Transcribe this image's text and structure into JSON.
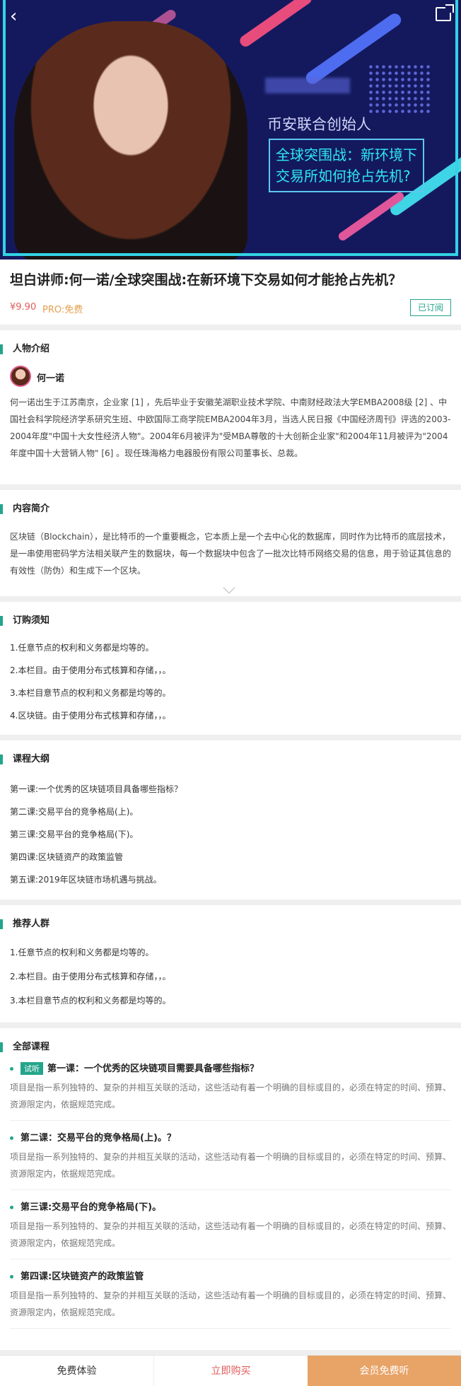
{
  "hero": {
    "subtitle": "币安联合创始人",
    "box_line1": "全球突围战：新环境下",
    "box_line2": "交易所如何抢占先机?",
    "back_icon": "chevron-left-icon",
    "share_icon": "share-icon"
  },
  "product": {
    "title": "坦白讲师:何一诺/全球突围战:在新环境下交易如何才能抢占先机？",
    "price": "¥9.90",
    "pro": "PRO:免费",
    "subscribed_label": "已订阅"
  },
  "intro": {
    "section_title": "人物介绍",
    "name": "何一诺",
    "text": "何一诺出生于江苏南京，企业家 [1] ，先后毕业于安徽芜湖职业技术学院、中南财经政法大学EMBA2008级 [2] 、中国社会科学院经济学系研究生班、中欧国际工商学院EMBA2004年3月，当选人民日报《中国经济周刊》评选的2003-2004年度\"中国十大女性经济人物\"。2004年6月被评为\"受MBA尊敬的十大创新企业家\"和2004年11月被评为\"2004年度中国十大营销人物\" [6] 。现任珠海格力电器股份有限公司董事长、总裁。"
  },
  "description": {
    "section_title": "内容简介",
    "text": "区块链（Blockchain），是比特币的一个重要概念，它本质上是一个去中心化的数据库，同时作为比特币的底层技术，是一串使用密码学方法相关联产生的数据块，每一个数据块中包含了一批次比特币网络交易的信息，用于验证其信息的有效性（防伪）和生成下一个区块。"
  },
  "notice": {
    "section_title": "订购须知",
    "items": [
      "1.任意节点的权利和义务都是均等的。",
      "2.本栏目。由于使用分布式核算和存储，，。",
      "3.本栏目意节点的权利和义务都是均等的。",
      "4.区块链。由于使用分布式核算和存储，，。"
    ]
  },
  "outline": {
    "section_title": "课程大纲",
    "items": [
      "第一课:一个优秀的区块链项目具备哪些指标？",
      "第二课:交易平台的竞争格局(上)。",
      "第三课:交易平台的竞争格局(下)。",
      "第四课:区块链资产的政策监管",
      "第五课:2019年区块链市场机遇与挑战。"
    ]
  },
  "crowd": {
    "section_title": "推荐人群",
    "items": [
      "1.任意节点的权利和义务都是均等的。",
      "2.本栏目。由于使用分布式核算和存储，，。",
      "3.本栏目意节点的权利和义务都是均等的。"
    ]
  },
  "courses": {
    "section_title": "全部课程",
    "trial_label": "试听",
    "lessons": [
      {
        "title": "第一课：一个优秀的区块链项目需要具备哪些指标？",
        "desc": "项目是指一系列独特的、复杂的并相互关联的活动，这些活动有着一个明确的目标或目的，必须在特定的时间、预算、资源限定内，依据规范完成。"
      },
      {
        "title": "第二课：交易平台的竞争格局(上)。？",
        "desc": "项目是指一系列独特的、复杂的并相互关联的活动，这些活动有着一个明确的目标或目的，必须在特定的时间、预算、资源限定内，依据规范完成。"
      },
      {
        "title": "第三课:交易平台的竞争格局(下)。",
        "desc": "项目是指一系列独特的、复杂的并相互关联的活动，这些活动有着一个明确的目标或目的，必须在特定的时间、预算、资源限定内，依据规范完成。"
      },
      {
        "title": "第四课:区块链资产的政策监管",
        "desc": "项目是指一系列独特的、复杂的并相互关联的活动，这些活动有着一个明确的目标或目的，必须在特定的时间、预算、资源限定内，依据规范完成。"
      }
    ]
  },
  "bottom_bar": {
    "free_trial": "免费体验",
    "buy_now": "立即购买",
    "member_free": "会员免费听"
  },
  "colors": {
    "accent": "#23a58b",
    "price": "#e25b5b",
    "member": "#e8a367",
    "hero_bg": "#14195e",
    "hero_box_text": "#2ee8f5"
  }
}
